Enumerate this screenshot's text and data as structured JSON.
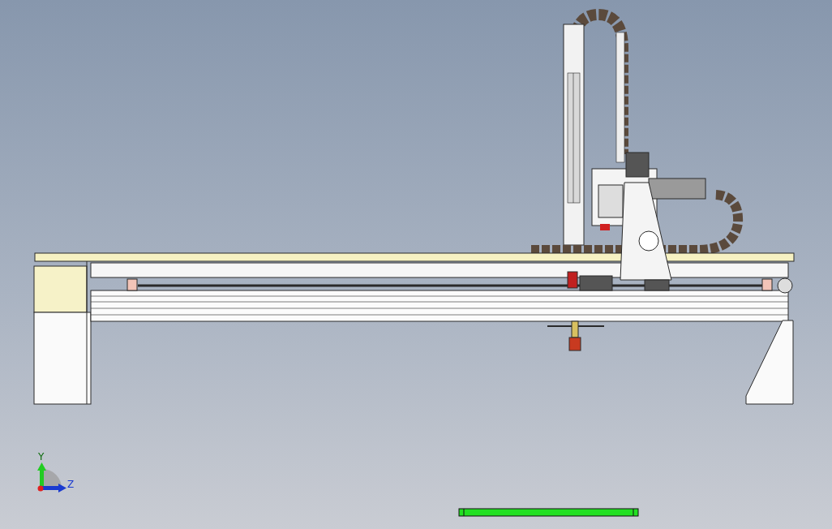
{
  "viewport": {
    "axis_triad": {
      "vertical_label": "Y",
      "horizontal_label": "Z"
    }
  }
}
